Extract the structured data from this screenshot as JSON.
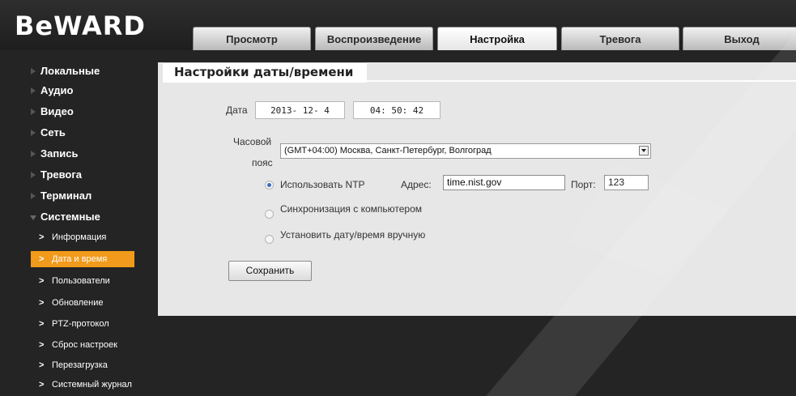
{
  "app": {
    "logo": "BeWARD"
  },
  "nav": {
    "tabs": [
      "Просмотр",
      "Воспроизведение",
      "Настройка",
      "Тревога",
      "Выход"
    ],
    "active": "Настройка"
  },
  "sidebar": {
    "sections": [
      "Локальные",
      "Аудио",
      "Видео",
      "Сеть",
      "Запись",
      "Тревога",
      "Терминал",
      "Системные"
    ],
    "open_section": "Системные",
    "sub_items": [
      "Информация",
      "Дата и время",
      "Пользователи",
      "Обновление",
      "PTZ-протокол",
      "Сброс настроек",
      "Перезагрузка",
      "Системный журнал"
    ],
    "active_sub": "Дата и время",
    "active_color": "#f29a1b"
  },
  "page": {
    "title": "Настройки даты/времени",
    "date_label": "Дата",
    "date_value": "2013- 12- 4",
    "time_value": "04: 50: 42",
    "timezone_label_1": "Часовой",
    "timezone_label_2": "пояс",
    "timezone_value": "(GMT+04:00) Москва, Санкт-Петербург, Волгоград",
    "options": {
      "ntp_label": "Использовать NTP",
      "address_label": "Адрес:",
      "address_value": "time.nist.gov",
      "port_label": "Порт:",
      "port_value": "123",
      "sync_pc_label": "Синхронизация с компьютером",
      "manual_label": "Установить дату/время вручную",
      "selected": "ntp"
    },
    "save_label": "Сохранить"
  }
}
